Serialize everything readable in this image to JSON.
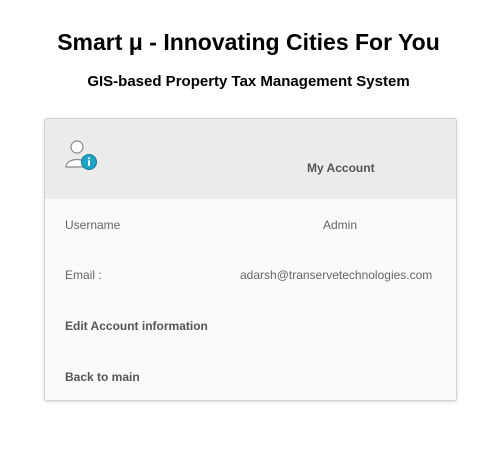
{
  "header": {
    "title": "Smart μ - Innovating Cities For You",
    "subtitle": "GIS-based Property Tax Management System"
  },
  "account_card": {
    "header_title": "My Account",
    "header_icon": "user-info-icon",
    "username_label": "Username",
    "username_value": "Admin",
    "email_label": "Email :",
    "email_value": "adarsh@transervetechnologies.com",
    "edit_link": "Edit Account information",
    "back_link": "Back to main"
  },
  "colors": {
    "header_bg": "#ebebeb",
    "card_bg": "#fafafa",
    "icon_badge": "#1fa3c4"
  }
}
